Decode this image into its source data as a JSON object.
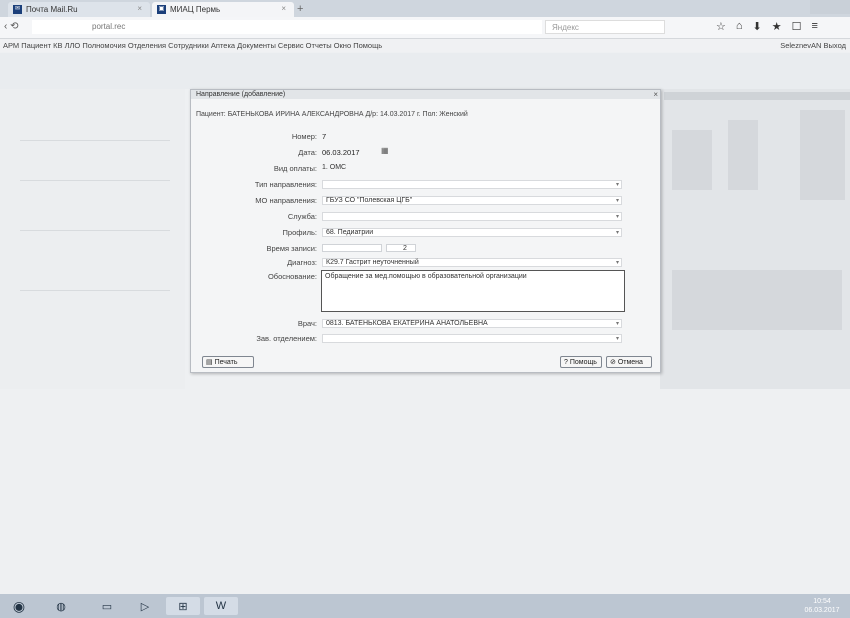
{
  "browser": {
    "tabs": [
      {
        "label": "Почта Mail.Ru",
        "icon": "mail-icon"
      },
      {
        "label": "МИАЦ Пермь",
        "icon": "site-icon"
      }
    ],
    "url": "portal.rec",
    "search_placeholder": "Яндекс",
    "menu_items": "АРМ Пациент КВ ЛЛО Полномочия Отделения Сотрудники Аптека Документы Сервис Отчеты Окно Помощь",
    "menu_right": "SeleznevAN Выход"
  },
  "dialog": {
    "title": "Направление (добавление)",
    "patient": "Пациент: БАТЕНЬКОВА ИРИНА АЛЕКСАНДРОВНА Д/р: 14.03.2017 г. Пол: Женский",
    "fields": {
      "nomer_label": "Номер:",
      "nomer_value": "7",
      "data_label": "Дата:",
      "data_value": "06.03.2017",
      "vid_oplaty_label": "Вид оплаты:",
      "vid_oplaty_value": "1. ОМС",
      "tip_label": "Тип направления:",
      "mo_label": "МО направления:",
      "mo_value": "ГБУЗ СО \"Полевская ЦГБ\"",
      "sluzhba_label": "Служба:",
      "profil_label": "Профиль:",
      "profil_value": "68. Педиатрии",
      "vremya_label": "Время записи:",
      "vremya_value": "2",
      "diagnoz_label": "Диагноз:",
      "diagnoz_value": "К29.7 Гастрит неуточненный",
      "obosnovanie_label": "Обоснование:",
      "obosnovanie_value": "Обращение за мед.помощью в образовательной организации",
      "vrach_label": "Врач:",
      "vrach_value": "0813. БАТЕНЬКОВА ЕКАТЕРИНА АНАТОЛЬЕВНА",
      "zav_label": "Зав. отделением:"
    },
    "buttons": {
      "print": "Печать",
      "save": "Помощь",
      "cancel": "Отмена"
    }
  },
  "taskbar": {
    "items": [
      "windows-start",
      "firefox",
      "explorer",
      "media-player",
      "network",
      "word"
    ],
    "word_label": "W",
    "clock_time": "10:54",
    "clock_date": "06.03.2017"
  }
}
